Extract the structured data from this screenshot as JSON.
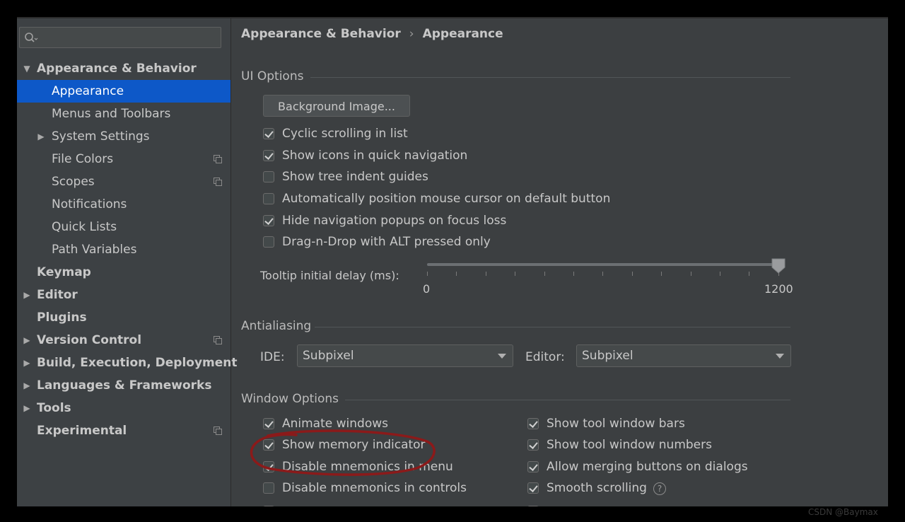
{
  "search": {
    "placeholder": ""
  },
  "sidebar": {
    "items": [
      {
        "label": "Appearance & Behavior",
        "expanded": true
      },
      {
        "label": "Appearance",
        "selected": true
      },
      {
        "label": "Menus and Toolbars"
      },
      {
        "label": "System Settings"
      },
      {
        "label": "File Colors"
      },
      {
        "label": "Scopes"
      },
      {
        "label": "Notifications"
      },
      {
        "label": "Quick Lists"
      },
      {
        "label": "Path Variables"
      },
      {
        "label": "Keymap"
      },
      {
        "label": "Editor"
      },
      {
        "label": "Plugins"
      },
      {
        "label": "Version Control"
      },
      {
        "label": "Build, Execution, Deployment"
      },
      {
        "label": "Languages & Frameworks"
      },
      {
        "label": "Tools"
      },
      {
        "label": "Experimental"
      }
    ]
  },
  "breadcrumb": {
    "parent": "Appearance & Behavior",
    "separator": "›",
    "current": "Appearance"
  },
  "ui_options": {
    "title": "UI Options",
    "background_image_button": "Background Image...",
    "checkboxes": [
      {
        "label": "Cyclic scrolling in list",
        "checked": true
      },
      {
        "label": "Show icons in quick navigation",
        "checked": true
      },
      {
        "label": "Show tree indent guides",
        "checked": false
      },
      {
        "label": "Automatically position mouse cursor on default button",
        "checked": false
      },
      {
        "label": "Hide navigation popups on focus loss",
        "checked": true
      },
      {
        "label": "Drag-n-Drop with ALT pressed only",
        "checked": false
      }
    ],
    "tooltip_delay": {
      "label": "Tooltip initial delay (ms):",
      "min": "0",
      "max": "1200",
      "value": 1200
    }
  },
  "antialiasing": {
    "title": "Antialiasing",
    "ide_label": "IDE:",
    "ide_value": "Subpixel",
    "editor_label": "Editor:",
    "editor_value": "Subpixel"
  },
  "window_options": {
    "title": "Window Options",
    "left": [
      {
        "label": "Animate windows",
        "checked": true
      },
      {
        "label": "Show memory indicator",
        "checked": true
      },
      {
        "label": "Disable mnemonics in menu",
        "checked": true
      },
      {
        "label": "Disable mnemonics in controls",
        "checked": false
      }
    ],
    "right": [
      {
        "label": "Show tool window bars",
        "checked": true
      },
      {
        "label": "Show tool window numbers",
        "checked": true
      },
      {
        "label": "Allow merging buttons on dialogs",
        "checked": true
      },
      {
        "label": "Smooth scrolling",
        "checked": true
      }
    ]
  },
  "watermark": "CSDN @Baymax",
  "colors": {
    "selection": "#0d58c8",
    "background": "#3c3f41",
    "annotation": "#8b1a1a"
  }
}
